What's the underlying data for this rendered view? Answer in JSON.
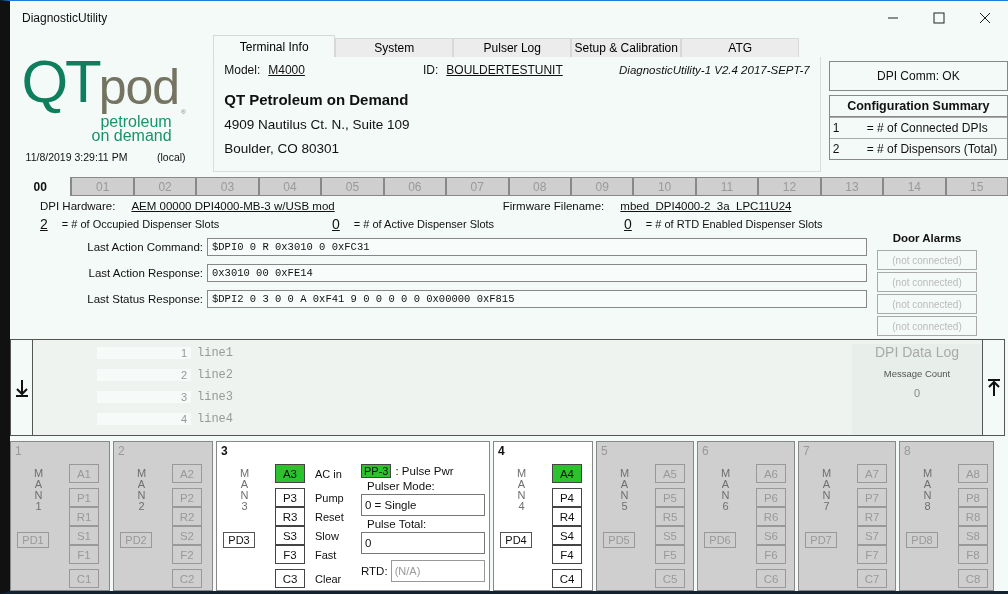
{
  "window": {
    "title": "DiagnosticUtility"
  },
  "logo": {
    "mark_left": "QT",
    "mark_right": "pod",
    "registered": "®",
    "tagline": [
      "petroleum",
      "on demand"
    ]
  },
  "clock": {
    "time": "11/8/2019 3:29:11 PM",
    "zone": "(local)"
  },
  "tabs": [
    {
      "label": "Terminal Info",
      "selected": true
    },
    {
      "label": "System",
      "selected": false
    },
    {
      "label": "Pulser Log",
      "selected": false
    },
    {
      "label": "Setup & Calibration",
      "selected": false
    },
    {
      "label": "ATG",
      "selected": false
    }
  ],
  "terminal": {
    "model_label": "Model:",
    "model": "M4000",
    "id_label": "ID:",
    "id": "BOULDERTESTUNIT",
    "version": "DiagnosticUtility-1 V2.4 2017-SEPT-7",
    "company": "QT Petroleum on Demand",
    "address": [
      "4909 Nautilus Ct. N., Suite 109",
      "Boulder, CO 80301"
    ]
  },
  "comm_status": "DPI Comm: OK",
  "config_summary": {
    "title": "Configuration Summary",
    "rows": [
      {
        "value": "1",
        "label": "= # of Connected DPIs"
      },
      {
        "value": "2",
        "label": "= # of Dispensors (Total)"
      }
    ]
  },
  "slot_tabs": [
    {
      "label": "00",
      "selected": true
    },
    {
      "label": "01",
      "selected": false
    },
    {
      "label": "02",
      "selected": false
    },
    {
      "label": "03",
      "selected": false
    },
    {
      "label": "04",
      "selected": false
    },
    {
      "label": "05",
      "selected": false
    },
    {
      "label": "06",
      "selected": false
    },
    {
      "label": "07",
      "selected": false
    },
    {
      "label": "08",
      "selected": false
    },
    {
      "label": "09",
      "selected": false
    },
    {
      "label": "10",
      "selected": false
    },
    {
      "label": "11",
      "selected": false
    },
    {
      "label": "12",
      "selected": false
    },
    {
      "label": "13",
      "selected": false
    },
    {
      "label": "14",
      "selected": false
    },
    {
      "label": "15",
      "selected": false
    }
  ],
  "hardware": {
    "label": "DPI Hardware:",
    "value": "AEM 00000 DPI4000-MB-3 w/USB mod",
    "firmware_label": "Firmware Filename:",
    "firmware": "mbed_DPI4000-2_3a_LPC11U24"
  },
  "counts": [
    {
      "value": "2",
      "label": "= # of Occupied Dispenser Slots"
    },
    {
      "value": "0",
      "label": "= # of Active Dispenser Slots"
    },
    {
      "value": "0",
      "label": "= # of RTD Enabled Dispenser Slots"
    }
  ],
  "messages": [
    {
      "label": "Last Action Command:",
      "value": "$DPI0 0 R 0x3010 0 0xFC31"
    },
    {
      "label": "Last Action Response:",
      "value": "0x3010 00 0xFE14"
    },
    {
      "label": "Last Status Response:",
      "value": "$DPI2 0 3 0 0 A 0xF41 9 0 0 0 0 0 0x00000 0xF815"
    }
  ],
  "door_alarms": {
    "title": "Door Alarms",
    "items": [
      "(not connected)",
      "(not connected)",
      "(not connected)",
      "(not connected)"
    ]
  },
  "log": {
    "lines": [
      {
        "number": "1",
        "text": "line1"
      },
      {
        "number": "2",
        "text": "line2"
      },
      {
        "number": "3",
        "text": "line3"
      },
      {
        "number": "4",
        "text": "line4"
      }
    ],
    "title": "DPI Data Log",
    "count_label": "Message Count",
    "count": "0"
  },
  "dispensers": [
    {
      "number": "1",
      "kind": "compact",
      "enabled": false,
      "man": "MAN1",
      "pd": "PD1",
      "ac": {
        "code": "A1",
        "on": false
      },
      "controls": [
        {
          "code": "P1"
        },
        {
          "code": "R1"
        },
        {
          "code": "S1"
        },
        {
          "code": "F1"
        }
      ],
      "clear": {
        "code": "C1"
      }
    },
    {
      "number": "2",
      "kind": "compact",
      "enabled": false,
      "man": "MAN2",
      "pd": "PD2",
      "ac": {
        "code": "A2",
        "on": false
      },
      "controls": [
        {
          "code": "P2"
        },
        {
          "code": "R2"
        },
        {
          "code": "S2"
        },
        {
          "code": "F2"
        }
      ],
      "clear": {
        "code": "C2"
      }
    },
    {
      "number": "3",
      "kind": "detail",
      "enabled": true,
      "man": "MAN3",
      "pd": "PD3",
      "ac": {
        "code": "A3",
        "on": true,
        "label": "AC in"
      },
      "controls": [
        {
          "code": "P3",
          "label": "Pump"
        },
        {
          "code": "R3",
          "label": "Reset"
        },
        {
          "code": "S3",
          "label": "Slow"
        },
        {
          "code": "F3",
          "label": "Fast"
        }
      ],
      "clear": {
        "code": "C3",
        "label": "Clear"
      },
      "pulser": {
        "power_code": "PP-3",
        "power_on": true,
        "power_label": ": Pulse Pwr",
        "mode_label": "Pulser Mode:",
        "mode": "0 = Single",
        "total_label": "Pulse Total:",
        "total": "0",
        "rtd_label": "RTD:",
        "rtd": "(N/A)"
      }
    },
    {
      "number": "4",
      "kind": "compact",
      "enabled": true,
      "man": "MAN4",
      "pd": "PD4",
      "ac": {
        "code": "A4",
        "on": true
      },
      "controls": [
        {
          "code": "P4"
        },
        {
          "code": "R4"
        },
        {
          "code": "S4"
        },
        {
          "code": "F4"
        }
      ],
      "clear": {
        "code": "C4"
      }
    },
    {
      "number": "5",
      "kind": "compact",
      "enabled": false,
      "man": "MAN5",
      "pd": "PD5",
      "ac": {
        "code": "A5",
        "on": false
      },
      "controls": [
        {
          "code": "P5"
        },
        {
          "code": "R5"
        },
        {
          "code": "S5"
        },
        {
          "code": "F5"
        }
      ],
      "clear": {
        "code": "C5"
      }
    },
    {
      "number": "6",
      "kind": "compact",
      "enabled": false,
      "man": "MAN6",
      "pd": "PD6",
      "ac": {
        "code": "A6",
        "on": false
      },
      "controls": [
        {
          "code": "P6"
        },
        {
          "code": "R6"
        },
        {
          "code": "S6"
        },
        {
          "code": "F6"
        }
      ],
      "clear": {
        "code": "C6"
      }
    },
    {
      "number": "7",
      "kind": "compact",
      "enabled": false,
      "man": "MAN7",
      "pd": "PD7",
      "ac": {
        "code": "A7",
        "on": false
      },
      "controls": [
        {
          "code": "P7"
        },
        {
          "code": "R7"
        },
        {
          "code": "S7"
        },
        {
          "code": "F7"
        }
      ],
      "clear": {
        "code": "C7"
      }
    },
    {
      "number": "8",
      "kind": "compact",
      "enabled": false,
      "man": "MAN8",
      "pd": "PD8",
      "ac": {
        "code": "A8",
        "on": false
      },
      "controls": [
        {
          "code": "P8"
        },
        {
          "code": "R8"
        },
        {
          "code": "S8"
        },
        {
          "code": "F8"
        }
      ],
      "clear": {
        "code": "C8"
      }
    }
  ]
}
